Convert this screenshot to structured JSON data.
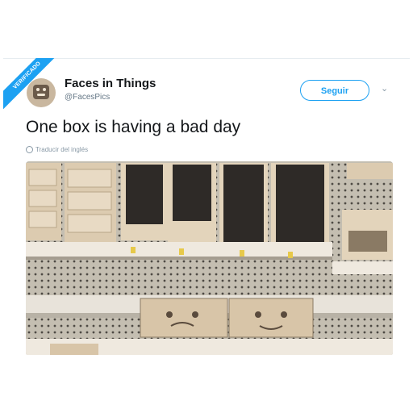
{
  "ribbon": {
    "text": "VERIFICADO"
  },
  "author": {
    "name": "Faces in Things",
    "handle": "@FacesPics"
  },
  "follow_button": {
    "label": "Seguir"
  },
  "tweet": {
    "text": "One box is having a bad day",
    "translate": "Traducir del inglés"
  },
  "colors": {
    "accent": "#1da1f2",
    "text": "#14171a",
    "muted": "#657786"
  },
  "icons": [
    "avatar",
    "chevron-down-icon",
    "globe-icon"
  ]
}
